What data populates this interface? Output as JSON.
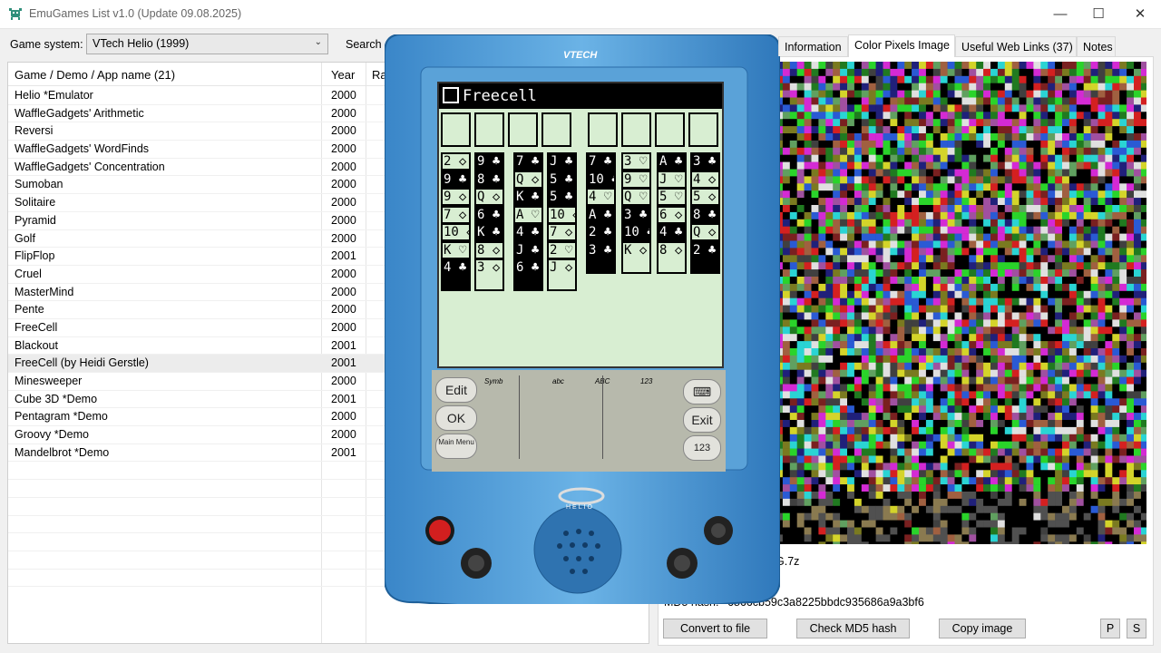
{
  "window": {
    "title": "EmuGames List v1.0 (Update 09.08.2025)",
    "minimize_glyph": "—",
    "maximize_glyph": "☐",
    "close_glyph": "✕"
  },
  "toolbar": {
    "system_label": "Game system:",
    "system_value": "VTech Helio (1999)",
    "search_label": "Search"
  },
  "list": {
    "col_name": "Game / Demo / App name (21)",
    "col_year": "Year",
    "col_third": "Ra",
    "selected_index": 15,
    "rows": [
      {
        "name": "Helio *Emulator",
        "year": "2000"
      },
      {
        "name": "WaffleGadgets' Arithmetic",
        "year": "2000"
      },
      {
        "name": "Reversi",
        "year": "2000"
      },
      {
        "name": "WaffleGadgets' WordFinds",
        "year": "2000"
      },
      {
        "name": "WaffleGadgets' Concentration",
        "year": "2000"
      },
      {
        "name": "Sumoban",
        "year": "2000"
      },
      {
        "name": "Solitaire",
        "year": "2000"
      },
      {
        "name": "Pyramid",
        "year": "2000"
      },
      {
        "name": "Golf",
        "year": "2000"
      },
      {
        "name": "FlipFlop",
        "year": "2001"
      },
      {
        "name": "Cruel",
        "year": "2000"
      },
      {
        "name": "MasterMind",
        "year": "2000"
      },
      {
        "name": "Pente",
        "year": "2000"
      },
      {
        "name": "FreeCell",
        "year": "2000"
      },
      {
        "name": "Blackout",
        "year": "2001"
      },
      {
        "name": "FreeCell (by Heidi Gerstle)",
        "year": "2001"
      },
      {
        "name": "Minesweeper",
        "year": "2000"
      },
      {
        "name": "Cube 3D *Demo",
        "year": "2001"
      },
      {
        "name": "Pentagram *Demo",
        "year": "2000"
      },
      {
        "name": "Groovy *Demo",
        "year": "2000"
      },
      {
        "name": "Mandelbrot *Demo",
        "year": "2001"
      }
    ]
  },
  "tabs": [
    {
      "label": "Information",
      "active": false
    },
    {
      "label": "Color Pixels Image",
      "active": true
    },
    {
      "label": "Useful Web Links (37)",
      "active": false
    },
    {
      "label": "Notes",
      "active": false
    }
  ],
  "details": {
    "file_suffix": "G.7z",
    "md5_label": "MD5 hash:",
    "md5_value": "6866cb59c3a8225bbdc935686a9a3bf6"
  },
  "buttons": {
    "convert": "Convert to file",
    "check_md5": "Check MD5 hash",
    "copy_image": "Copy image",
    "p": "P",
    "s": "S"
  },
  "device": {
    "brand": "VTECH",
    "model": "HELIO",
    "screen_title": "Freecell",
    "pad_labels": {
      "symb": "Symb",
      "abc": "abc",
      "ABC": "ABC",
      "num": "123"
    },
    "edit_label": "Edit",
    "ok_label": "OK",
    "main_menu_label": "Main Menu",
    "exit_label": "Exit",
    "num_button_label": "123",
    "columns": [
      [
        "2 ◇",
        "9 ♣",
        "9 ◇",
        "7 ◇",
        "10 ◇",
        "K ♡",
        "4 ♣"
      ],
      [
        "9 ♣",
        "8 ♣",
        "Q ◇",
        "6 ♣",
        "K ♣",
        "8 ◇",
        "3 ◇"
      ],
      [
        "7 ♣",
        "Q ◇",
        "K ♣",
        "A ♡",
        "4 ♣",
        "J ♣",
        "6 ♣"
      ],
      [
        "J ♣",
        "5 ♣",
        "5 ♣",
        "10 ◇",
        "7 ◇",
        "2 ♡",
        "J ◇"
      ],
      [
        "7 ♣",
        "10 ♣",
        "4 ♡",
        "A ♣",
        "2 ♣",
        "3 ♣"
      ],
      [
        "3 ♡",
        "9 ♡",
        "Q ♡",
        "3 ♣",
        "10 ♣",
        "K ◇"
      ],
      [
        "A ♣",
        "J ♡",
        "5 ♡",
        "6 ◇",
        "4 ♣",
        "8 ◇"
      ],
      [
        "3 ♣",
        "4 ◇",
        "5 ◇",
        "8 ♣",
        "Q ◇",
        "2 ♣"
      ]
    ]
  }
}
